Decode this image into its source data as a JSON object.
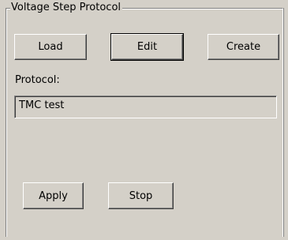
{
  "group": {
    "title": "Voltage Step Protocol"
  },
  "buttons": {
    "load": "Load",
    "edit": "Edit",
    "create": "Create",
    "apply": "Apply",
    "stop": "Stop"
  },
  "protocol": {
    "label": "Protocol:",
    "value": "TMC test"
  }
}
